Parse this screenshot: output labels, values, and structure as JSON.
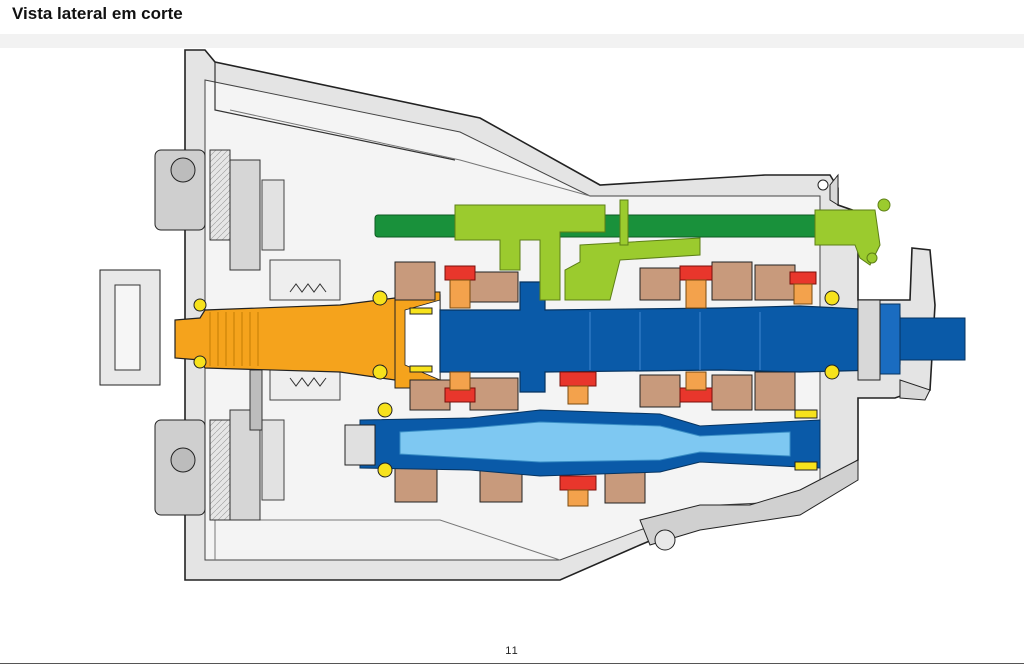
{
  "page": {
    "title": "Vista lateral em corte",
    "page_number": "11"
  },
  "colors": {
    "housing": "#dcdcdc",
    "housing_outline": "#222222",
    "input_shaft": "#f5a31c",
    "main_shaft": "#0a5aa8",
    "countershaft": "#7ec8f2",
    "gears": "#c89a7c",
    "shift_rail": "#19913b",
    "shift_fork": "#9bcb2e",
    "synchronizer": "#e8362c",
    "bearing": "#f7e21c",
    "synchro_hub": "#f3a24c"
  }
}
